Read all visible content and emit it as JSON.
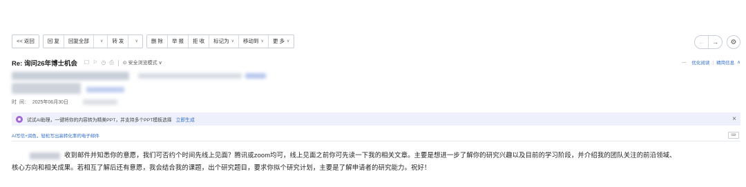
{
  "toolbar": {
    "back": "<< 返回",
    "reply": "回 复",
    "reply_all": "回复全部",
    "forward": "转 发",
    "delete": "删 除",
    "report": "举 报",
    "reject": "拒 收",
    "mark_as": "标记为",
    "move_to": "移动到",
    "more": "更 多"
  },
  "nav": {
    "prev": "←",
    "next": "→",
    "settings": "⚙"
  },
  "email": {
    "subject": "Re: 询问26年博士机会",
    "safe_mode": "安全浏览模式",
    "optimized_read": "优化阅读",
    "brief_info": "精简信息",
    "time_label": "时 间:",
    "time_value": "2025年06月30日"
  },
  "banner": {
    "text": "试试AI助理，一键将你的内容转为精美PPT，并支持多个PPT模板选择",
    "link": "立即生成",
    "close": "×"
  },
  "ai_hint": {
    "text": "AI写信+润色，轻松写出高转化率的电子邮件"
  },
  "body": {
    "line1": "收到邮件并知悉你的意愿，我们可否约个时间先线上见面？腾讯或zoom均可，线上见面之前你可先读一下我的相关文章。主要是想进一步了解你的研究兴趣以及目前的学习阶段，并介绍我的团队关注的前沿领域、",
    "line2": "核心方向和相关成果。若相互了解后还有意愿，我会结合我的课题，出个研究题目，要求你拟个研究计划，主要是了解申请者的研究能力。祝好！"
  }
}
